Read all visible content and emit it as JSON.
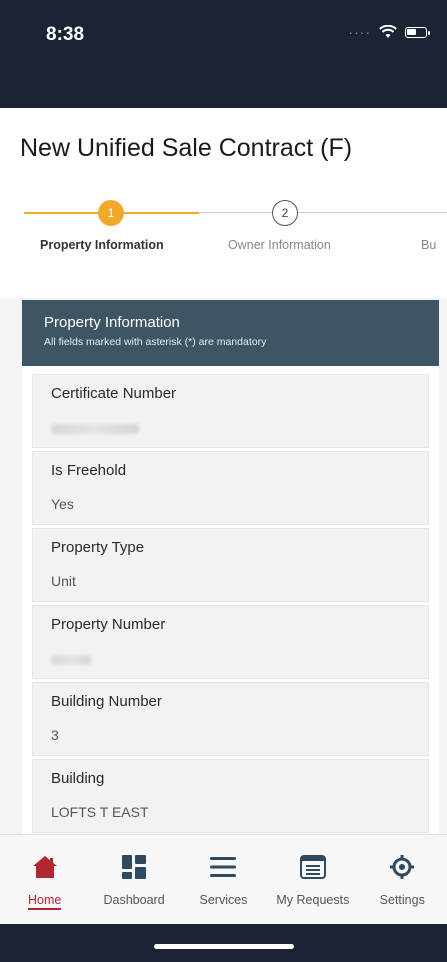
{
  "status": {
    "time": "8:38",
    "icons": [
      "signal-dots-icon",
      "wifi-icon",
      "battery-icon"
    ]
  },
  "page": {
    "title": "New Unified Sale Contract (F)"
  },
  "stepper": {
    "steps": [
      {
        "number": "1",
        "label": "Property Information",
        "state": "active"
      },
      {
        "number": "2",
        "label": "Owner Information",
        "state": "pending"
      },
      {
        "number": "",
        "label": "Bu",
        "state": "pending"
      }
    ],
    "active_color": "#f0a92a"
  },
  "section": {
    "title": "Property Information",
    "subtitle": "All fields marked with asterisk (*) are mandatory",
    "header_color": "#3e5664"
  },
  "fields": [
    {
      "label": "Certificate Number",
      "value": "",
      "redacted": true
    },
    {
      "label": "Is Freehold",
      "value": "Yes"
    },
    {
      "label": "Property Type",
      "value": "Unit"
    },
    {
      "label": "Property Number",
      "value": "",
      "redacted": true
    },
    {
      "label": "Building Number",
      "value": "3"
    },
    {
      "label": "Building",
      "value": "LOFTS T EAST"
    }
  ],
  "tabbar": {
    "items": [
      {
        "label": "Home",
        "icon": "home-icon",
        "active": true
      },
      {
        "label": "Dashboard",
        "icon": "dashboard-icon",
        "active": false
      },
      {
        "label": "Services",
        "icon": "menu-icon",
        "active": false
      },
      {
        "label": "My Requests",
        "icon": "requests-icon",
        "active": false
      },
      {
        "label": "Settings",
        "icon": "gear-icon",
        "active": false
      }
    ],
    "active_color": "#b22634",
    "icon_color": "#2f4a5e"
  }
}
